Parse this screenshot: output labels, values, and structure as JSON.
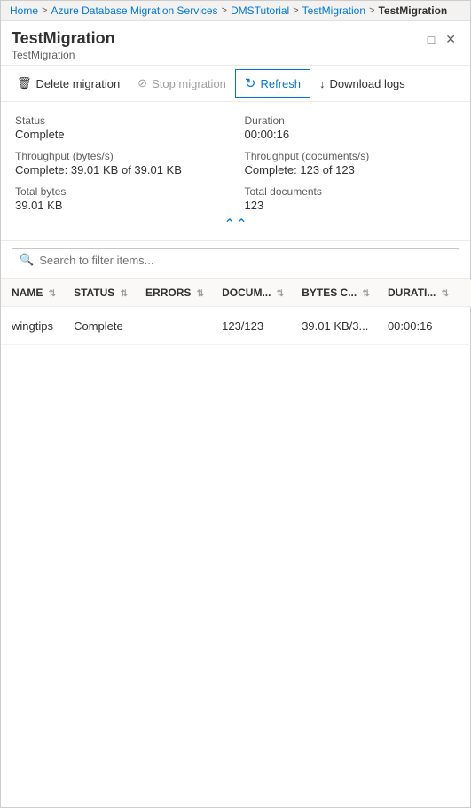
{
  "breadcrumb": {
    "items": [
      {
        "label": "Home",
        "link": true
      },
      {
        "label": "Azure Database Migration Services",
        "link": true
      },
      {
        "label": "DMSTutorial",
        "link": true
      },
      {
        "label": "TestMigration",
        "link": true
      },
      {
        "label": "TestMigration",
        "link": false,
        "current": true
      }
    ],
    "separator": ">"
  },
  "header": {
    "title": "TestMigration",
    "subtitle": "TestMigration",
    "window_button_maximize": "□",
    "window_button_close": "✕"
  },
  "toolbar": {
    "delete_label": "Delete migration",
    "stop_label": "Stop migration",
    "refresh_label": "Refresh",
    "download_label": "Download logs"
  },
  "status": {
    "status_label": "Status",
    "status_value": "Complete",
    "duration_label": "Duration",
    "duration_value": "00:00:16",
    "throughput_bytes_label": "Throughput (bytes/s)",
    "throughput_bytes_value": "Complete: 39.01 KB of 39.01 KB",
    "throughput_docs_label": "Throughput (documents/s)",
    "throughput_docs_value": "Complete: 123 of 123",
    "total_bytes_label": "Total bytes",
    "total_bytes_value": "39.01 KB",
    "total_docs_label": "Total documents",
    "total_docs_value": "123"
  },
  "search": {
    "placeholder": "Search to filter items..."
  },
  "table": {
    "columns": [
      {
        "key": "name",
        "label": "NAME"
      },
      {
        "key": "status",
        "label": "STATUS"
      },
      {
        "key": "errors",
        "label": "ERRORS"
      },
      {
        "key": "documents",
        "label": "DOCUM..."
      },
      {
        "key": "bytes",
        "label": "BYTES C..."
      },
      {
        "key": "duration",
        "label": "DURATI..."
      }
    ],
    "rows": [
      {
        "name": "wingtips",
        "status": "Complete",
        "errors": "",
        "documents": "123/123",
        "bytes": "39.01 KB/3...",
        "duration": "00:00:16",
        "has_menu": true
      }
    ]
  }
}
